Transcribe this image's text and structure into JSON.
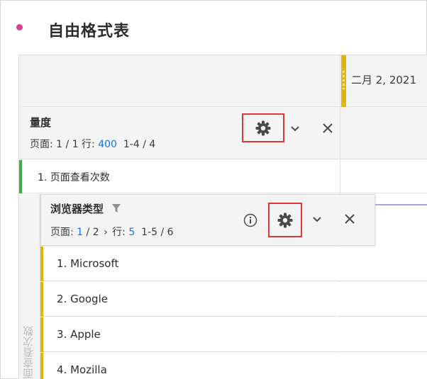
{
  "panel": {
    "title": "自由格式表"
  },
  "header": {
    "date": "二月 2, 2021"
  },
  "metrics": {
    "title": "量度",
    "page_prefix": "页面: ",
    "page_value": "1 / 1",
    "rows_prefix": " 行: ",
    "rows_value": "400",
    "range": "1-4 / 4",
    "items": [
      {
        "label": "1. 页面查看次数"
      }
    ]
  },
  "breakdown": {
    "title": "浏览器类型",
    "page_prefix": "页面: ",
    "page_value": "1",
    "page_total": " / 2",
    "next_arrow": "›",
    "rows_prefix": " 行: ",
    "rows_value": "5",
    "range": "1-5 / 6",
    "side_label": "页面查看次数",
    "items": [
      {
        "label": "1. Microsoft"
      },
      {
        "label": "2. Google"
      },
      {
        "label": "3. Apple"
      },
      {
        "label": "4. Mozilla"
      }
    ]
  },
  "colors": {
    "accent_pink": "#d9408e",
    "highlight_red": "#e0363b",
    "link_blue": "#1473e6",
    "metric_green": "#3fae49",
    "dimension_yellow": "#e1b40e",
    "trend_line": "#a9a6dd"
  },
  "icons": {
    "settings": "gear-icon",
    "expand": "chevron-down-icon",
    "remove": "close-icon",
    "info": "info-icon",
    "filter": "filter-icon",
    "bullet": "dot-icon",
    "drag": "drag-handle-icon"
  }
}
